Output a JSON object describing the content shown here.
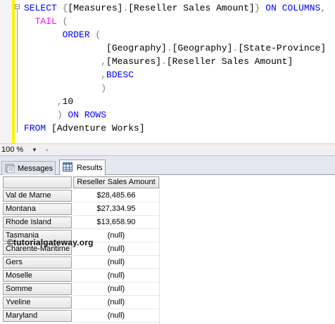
{
  "editor": {
    "lines": [
      [
        {
          "c": "kw",
          "t": "SELECT "
        },
        {
          "c": "pn",
          "t": "{"
        },
        {
          "c": "txt",
          "t": "[Measures]"
        },
        {
          "c": "pn",
          "t": "."
        },
        {
          "c": "txt",
          "t": "[Reseller Sales Amount]"
        },
        {
          "c": "pn",
          "t": "}"
        },
        {
          "c": "kw",
          "t": " ON COLUMNS"
        },
        {
          "c": "pn",
          "t": ","
        }
      ],
      [
        {
          "c": "txt",
          "t": "  "
        },
        {
          "c": "fn",
          "t": "TAIL"
        },
        {
          "c": "pn",
          "t": " ("
        }
      ],
      [
        {
          "c": "txt",
          "t": "       "
        },
        {
          "c": "kw",
          "t": "ORDER"
        },
        {
          "c": "pn",
          "t": " ("
        }
      ],
      [
        {
          "c": "txt",
          "t": "               "
        },
        {
          "c": "txt",
          "t": "[Geography]"
        },
        {
          "c": "pn",
          "t": "."
        },
        {
          "c": "txt",
          "t": "[Geography]"
        },
        {
          "c": "pn",
          "t": "."
        },
        {
          "c": "txt",
          "t": "[State-Province]"
        }
      ],
      [
        {
          "c": "txt",
          "t": "              "
        },
        {
          "c": "pn",
          "t": ","
        },
        {
          "c": "txt",
          "t": "[Measures]"
        },
        {
          "c": "pn",
          "t": "."
        },
        {
          "c": "txt",
          "t": "[Reseller Sales Amount]"
        }
      ],
      [
        {
          "c": "txt",
          "t": "              "
        },
        {
          "c": "pn",
          "t": ","
        },
        {
          "c": "kw",
          "t": "BDESC"
        }
      ],
      [
        {
          "c": "txt",
          "t": "              "
        },
        {
          "c": "pn",
          "t": ")"
        }
      ],
      [
        {
          "c": "txt",
          "t": "      "
        },
        {
          "c": "pn",
          "t": ","
        },
        {
          "c": "txt",
          "t": "10"
        }
      ],
      [
        {
          "c": "txt",
          "t": "      "
        },
        {
          "c": "pn",
          "t": ") "
        },
        {
          "c": "kw",
          "t": "ON ROWS"
        }
      ],
      [
        {
          "c": "kw",
          "t": "FROM "
        },
        {
          "c": "txt",
          "t": "[Adventure Works]"
        }
      ]
    ]
  },
  "status": {
    "zoom": "100 %",
    "zoom_dropdown_icon": "▾",
    "scroll_left_icon": "◂"
  },
  "tabs": {
    "messages_label": "Messages",
    "results_label": "Results"
  },
  "results": {
    "column_header": "Reseller Sales Amount",
    "rows": [
      {
        "label": "Val de Marne",
        "value": "$28,485.66"
      },
      {
        "label": "Montana",
        "value": "$27,334.95"
      },
      {
        "label": "Rhode Island",
        "value": "$13,658.90"
      },
      {
        "label": "Tasmania",
        "value": "(null)"
      },
      {
        "label": "Charente-Maritime",
        "value": "(null)"
      },
      {
        "label": "Gers",
        "value": "(null)"
      },
      {
        "label": "Moselle",
        "value": "(null)"
      },
      {
        "label": "Somme",
        "value": "(null)"
      },
      {
        "label": "Yveline",
        "value": "(null)"
      },
      {
        "label": "Maryland",
        "value": "(null)"
      }
    ]
  },
  "watermark": "©tutorialgateway.org",
  "colors": {
    "keyword": "#0000ff",
    "function": "#ff00ff",
    "change_bar": "#fff200"
  }
}
